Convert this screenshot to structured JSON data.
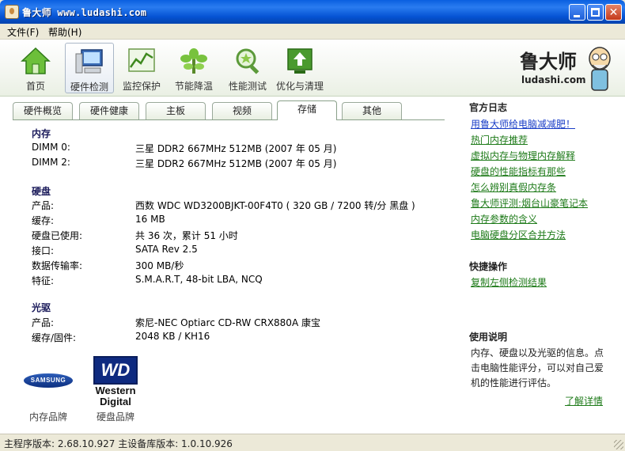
{
  "window": {
    "title": "鲁大师  www.ludashi.com"
  },
  "menu": [
    {
      "label": "文件(F)"
    },
    {
      "label": "帮助(H)"
    }
  ],
  "toolbar": {
    "items": [
      {
        "label": "首页",
        "icon": "home-icon"
      },
      {
        "label": "硬件检测",
        "icon": "computer-icon"
      },
      {
        "label": "监控保护",
        "icon": "monitor-chart-icon"
      },
      {
        "label": "节能降温",
        "icon": "plant-icon"
      },
      {
        "label": "性能测试",
        "icon": "magnifier-star-icon"
      },
      {
        "label": "优化与清理",
        "icon": "upload-board-icon"
      }
    ],
    "active_index": 1
  },
  "logo": {
    "cn": "鲁大师",
    "en": "ludashi.com"
  },
  "tabs": [
    {
      "label": "硬件概览"
    },
    {
      "label": "硬件健康"
    },
    {
      "label": "主板"
    },
    {
      "label": "视频"
    },
    {
      "label": "存储"
    },
    {
      "label": "其他"
    }
  ],
  "active_tab": 4,
  "memory": {
    "heading": "内存",
    "rows": [
      {
        "key": "DIMM 0:",
        "value": "三星 DDR2 667MHz 512MB (2007 年 05 月)"
      },
      {
        "key": "DIMM 2:",
        "value": "三星 DDR2 667MHz 512MB (2007 年 05 月)"
      }
    ]
  },
  "disk": {
    "heading": "硬盘",
    "rows": [
      {
        "key": "产品:",
        "value": "西数 WDC WD3200BJKT-00F4T0 ( 320 GB / 7200 转/分 黑盘 )"
      },
      {
        "key": "缓存:",
        "value": "16 MB"
      },
      {
        "key": "硬盘已使用:",
        "value": "共 36 次，累计 51 小时"
      },
      {
        "key": "接口:",
        "value": "SATA Rev 2.5"
      },
      {
        "key": "数据传输率:",
        "value": "300 MB/秒"
      },
      {
        "key": "特征:",
        "value": "S.M.A.R.T,  48-bit LBA,  NCQ"
      }
    ]
  },
  "optical": {
    "heading": "光驱",
    "rows": [
      {
        "key": "产品:",
        "value": "索尼-NEC Optiarc CD-RW CRX880A 康宝"
      },
      {
        "key": "缓存/固件:",
        "value": "2048 KB / KH16"
      }
    ]
  },
  "brands": {
    "memory": {
      "logo_text": "SAMSUNG",
      "caption": "内存品牌"
    },
    "disk": {
      "logo_mark": "WD",
      "logo_line1": "Western",
      "logo_line2": "Digital",
      "caption": "硬盘品牌"
    }
  },
  "sidebar": {
    "blog_heading": "官方日志",
    "blog_links": [
      "用鲁大师给电脑减减肥！",
      "热门内存推荐",
      "虚拟内存与物理内存解释",
      "硬盘的性能指标有那些",
      "怎么辨别真假内存条",
      "鲁大师评测:烟台山豪笔记本",
      "内存参数的含义",
      "电脑硬盘分区合并方法"
    ],
    "quick_heading": "快捷操作",
    "quick_link": "复制左侧检测结果",
    "help_heading": "使用说明",
    "help_text": "内存、硬盘以及光驱的信息。点击电脑性能评分，可以对自己爱机的性能进行评估。",
    "more_link": "了解详情"
  },
  "status": {
    "text": "主程序版本: 2.68.10.927  主设备库版本: 1.0.10.926"
  },
  "colors": {
    "link_blue": "#1a3ec7",
    "link_green": "#1d7a18",
    "title_bar": "#0a5fe0"
  }
}
